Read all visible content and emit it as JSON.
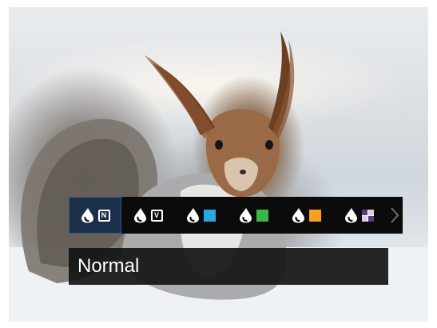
{
  "viewfinder": {
    "subject_icon": "squirrel-in-snow-scene"
  },
  "effect_menu": {
    "selected_index": 0,
    "items": [
      {
        "icon": "drop-icon",
        "badge_type": "letter",
        "badge_text": "N"
      },
      {
        "icon": "drop-icon",
        "badge_type": "letter",
        "badge_text": "V"
      },
      {
        "icon": "drop-icon",
        "badge_type": "color",
        "badge_color": "#29a8e0"
      },
      {
        "icon": "drop-icon",
        "badge_type": "color",
        "badge_color": "#3bb54a"
      },
      {
        "icon": "drop-icon",
        "badge_type": "color",
        "badge_color": "#f5a025"
      },
      {
        "icon": "drop-icon",
        "badge_type": "quad",
        "badge_colors": [
          "#5b3d7a",
          "#d9cfe4",
          "#d9cfe4",
          "#5b3d7a"
        ]
      }
    ],
    "more_icon": "chevron-right-icon"
  },
  "selected_effect": {
    "label": "Normal"
  },
  "colors": {
    "menu_bg": "#0b0b0b",
    "selected_bg": "#1b2f4a",
    "label_bg": "#141414",
    "text": "#ffffff"
  }
}
